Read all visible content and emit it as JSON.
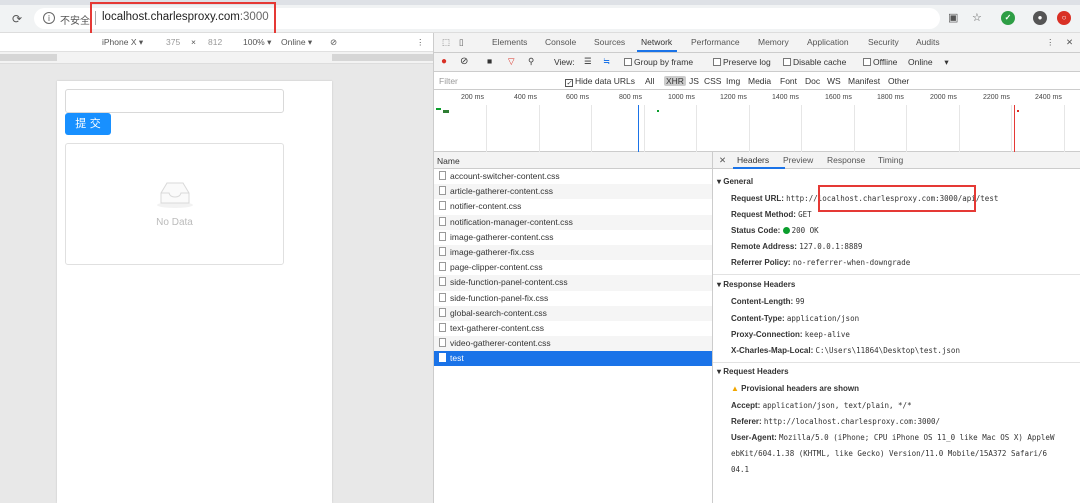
{
  "browser": {
    "reload_icon": "reload-icon",
    "info_icon": "info-icon",
    "insecure_label": "不安全",
    "url_host": "localhost.charlesproxy.com",
    "url_port": ":3000"
  },
  "device_toolbar": {
    "device": "iPhone X ▾",
    "width": "375",
    "times": "×",
    "height": "812",
    "zoom": "100% ▾",
    "network": "Online ▾"
  },
  "page": {
    "submit_label": "提 交",
    "empty_text": "No Data"
  },
  "devtools": {
    "tabs": [
      "Elements",
      "Console",
      "Sources",
      "Network",
      "Performance",
      "Memory",
      "Application",
      "Security",
      "Audits"
    ],
    "toolbar": {
      "view_label": "View:",
      "group_by_frame": "Group by frame",
      "preserve_log": "Preserve log",
      "disable_cache": "Disable cache",
      "offline": "Offline",
      "online": "Online"
    },
    "filter": {
      "placeholder": "Filter",
      "hide_data_urls": "Hide data URLs",
      "types": [
        "All",
        "XHR",
        "JS",
        "CSS",
        "Img",
        "Media",
        "Font",
        "Doc",
        "WS",
        "Manifest",
        "Other"
      ]
    },
    "timeline_ticks": [
      "200 ms",
      "400 ms",
      "600 ms",
      "800 ms",
      "1000 ms",
      "1200 ms",
      "1400 ms",
      "1600 ms",
      "1800 ms",
      "2000 ms",
      "2200 ms",
      "2400 ms"
    ],
    "name_header": "Name",
    "requests": [
      "account-switcher-content.css",
      "article-gatherer-content.css",
      "notifier-content.css",
      "notification-manager-content.css",
      "image-gatherer-content.css",
      "image-gatherer-fix.css",
      "page-clipper-content.css",
      "side-function-panel-content.css",
      "side-function-panel-fix.css",
      "global-search-content.css",
      "text-gatherer-content.css",
      "video-gatherer-content.css",
      "test"
    ],
    "detail_tabs": [
      "Headers",
      "Preview",
      "Response",
      "Timing"
    ],
    "general": {
      "title": "General",
      "request_url_label": "Request URL:",
      "request_url_prefix": "http://",
      "request_url_host": "localhost.charlesproxy.com:3000",
      "request_url_path": "/api/test",
      "method_label": "Request Method:",
      "method": "GET",
      "status_label": "Status Code:",
      "status": "200 OK",
      "remote_label": "Remote Address:",
      "remote": "127.0.0.1:8889",
      "referrer_policy_label": "Referrer Policy:",
      "referrer_policy": "no-referrer-when-downgrade"
    },
    "response_headers": {
      "title": "Response Headers",
      "items": [
        {
          "k": "Content-Length:",
          "v": "99"
        },
        {
          "k": "Content-Type:",
          "v": "application/json"
        },
        {
          "k": "Proxy-Connection:",
          "v": "keep-alive"
        },
        {
          "k": "X-Charles-Map-Local:",
          "v": "C:\\Users\\11864\\Desktop\\test.json"
        }
      ]
    },
    "request_headers": {
      "title": "Request Headers",
      "warning": "Provisional headers are shown",
      "accept_label": "Accept:",
      "accept": "application/json, text/plain, */*",
      "referer_label": "Referer:",
      "referer": "http://localhost.charlesproxy.com:3000/",
      "ua_label": "User-Agent:",
      "ua_line1": "Mozilla/5.0 (iPhone; CPU iPhone OS 11_0 like Mac OS X) AppleW",
      "ua_line2": "ebKit/604.1.38 (KHTML, like Gecko) Version/11.0 Mobile/15A372 Safari/6",
      "ua_line3": "04.1"
    }
  },
  "colors": {
    "accent": "#1a73e8",
    "highlight_box": "#e53935",
    "antd_blue": "#1890ff"
  }
}
